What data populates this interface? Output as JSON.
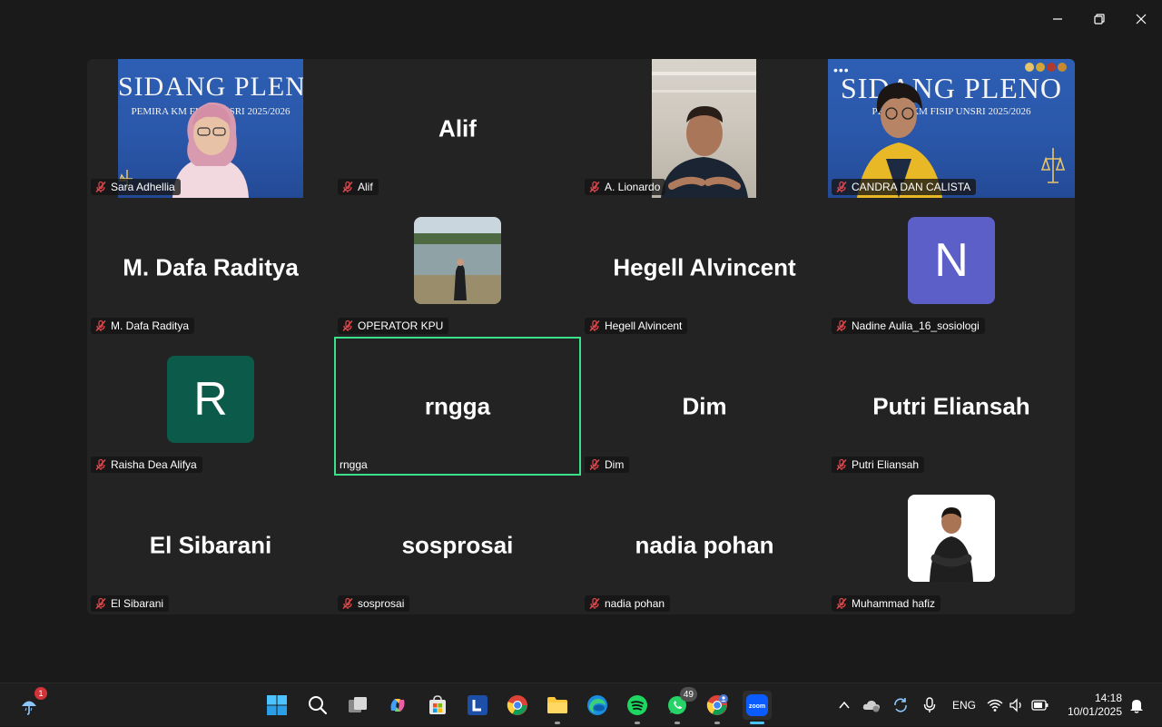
{
  "window": {
    "controls": [
      "minimize-icon",
      "restore-icon",
      "close-icon"
    ]
  },
  "tiles": [
    {
      "name": "Sara Adhellia",
      "kind": "video",
      "banner": "SIDANG PLENO",
      "banner_sub": "PEMIRA KM FISIP UNSRI 2025/2026"
    },
    {
      "name": "Alif",
      "kind": "name"
    },
    {
      "name": "A. Lionardo",
      "kind": "video"
    },
    {
      "name": "CANDRA DAN CALISTA",
      "kind": "video",
      "banner": "SIDANG PLENO",
      "banner_sub": "PEMIRA KM FISIP UNSRI 2025/2026"
    },
    {
      "name": "M. Dafa Raditya",
      "kind": "name"
    },
    {
      "name": "OPERATOR KPU",
      "kind": "photo"
    },
    {
      "name": "Hegell Alvincent",
      "kind": "name"
    },
    {
      "name": "Nadine Aulia_16_sosiologi",
      "kind": "avatar",
      "initial": "N",
      "color": "#5b5fc7"
    },
    {
      "name": "Raisha Dea Alifya",
      "kind": "avatar",
      "initial": "R",
      "color": "#0b5a4a"
    },
    {
      "name": "rngga",
      "kind": "name",
      "active": true
    },
    {
      "name": "Dim",
      "kind": "name"
    },
    {
      "name": "Putri Eliansah",
      "kind": "name"
    },
    {
      "name": "El Sibarani",
      "kind": "name"
    },
    {
      "name": "sosprosai",
      "kind": "name"
    },
    {
      "name": "nadia pohan",
      "kind": "name"
    },
    {
      "name": "Muhammad hafiz",
      "kind": "photo"
    }
  ],
  "taskbar": {
    "weather_badge": "1",
    "whatsapp_badge": "49",
    "lang": "ENG",
    "time": "14:18",
    "date": "10/01/2025",
    "zoom_label": "zoom"
  },
  "colors": {
    "active_speaker": "#3ae08a",
    "muted_mic": "#e5484d",
    "accent": "#4cc2ff"
  }
}
